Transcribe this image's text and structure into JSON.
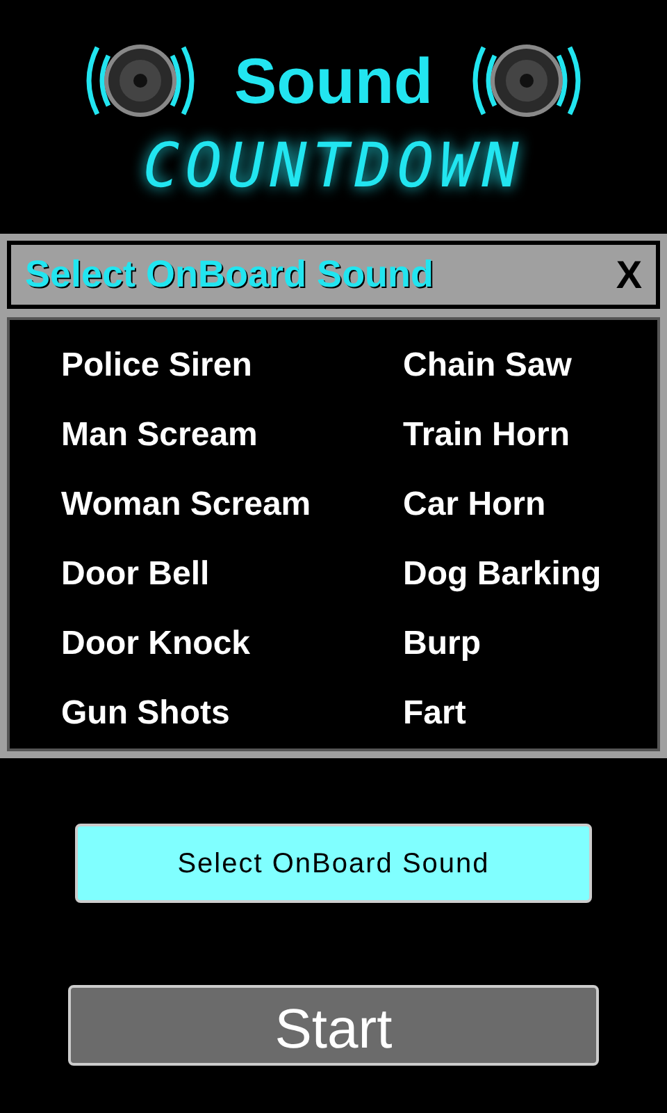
{
  "logo": {
    "title": "Sound",
    "subtitle": "COUNTDOWN"
  },
  "dialog": {
    "title": "Select OnBoard Sound",
    "close": "X",
    "sounds": [
      "Police Siren",
      "Chain Saw",
      "Man Scream",
      "Train Horn",
      "Woman Scream",
      "Car Horn",
      "Door Bell",
      "Dog Barking",
      "Door Knock",
      "Burp",
      "Gun Shots",
      "Fart"
    ]
  },
  "select_button": "Select OnBoard Sound",
  "start_button": "Start"
}
